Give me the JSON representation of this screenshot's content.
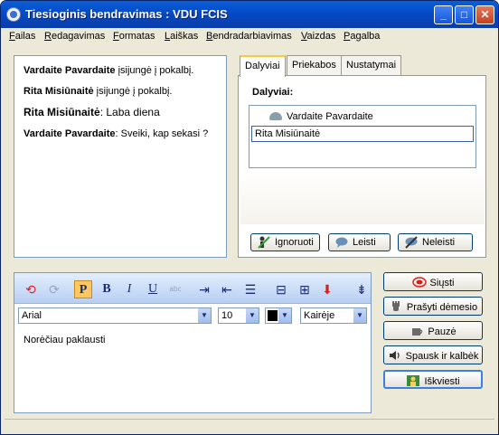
{
  "window": {
    "title": "Tiesioginis bendravimas : VDU FCIS"
  },
  "menu": [
    "Failas",
    "Redagavimas",
    "Formatas",
    "Laiškas",
    "Bendradarbiavimas",
    "Vaizdas",
    "Pagalba"
  ],
  "chat": {
    "messages": [
      {
        "author": "Vardaite Pavardaite",
        "text": " įsijungė į pokalbį."
      },
      {
        "author": "Rita Misiūnaitė",
        "text": " įsijungė į pokalbį."
      },
      {
        "author": "Rita Misiūnaitė",
        "text": ": Laba diena"
      },
      {
        "author": "Vardaite Pavardaite",
        "text": ": Sveiki, kap sekasi ?"
      }
    ]
  },
  "tabs": {
    "items": [
      "Dalyviai",
      "Priekabos",
      "Nustatymai"
    ]
  },
  "participants": {
    "label": "Dalyviai:",
    "list": [
      "Vardaite Pavardaite",
      "Rita Misiūnaitė"
    ],
    "buttons": {
      "ignore": "Ignoruoti",
      "allow": "Leisti",
      "deny": "Neleisti"
    }
  },
  "editor": {
    "font": "Arial",
    "size": "10",
    "align": "Kairėje",
    "text": "Norėčiau paklausti",
    "toolbar": {
      "p": "P",
      "b": "B",
      "i": "I",
      "u": "U"
    }
  },
  "actions": {
    "send": "Siųsti",
    "attention": "Prašyti dėmesio",
    "pause": "Pauzė",
    "push_to_talk": "Spausk ir kalbėk",
    "invite": "Iškviesti"
  },
  "colors": {
    "title_bar": "#0a5fd8",
    "accent": "#ffc83c",
    "text_color_swatch": "#000000"
  }
}
